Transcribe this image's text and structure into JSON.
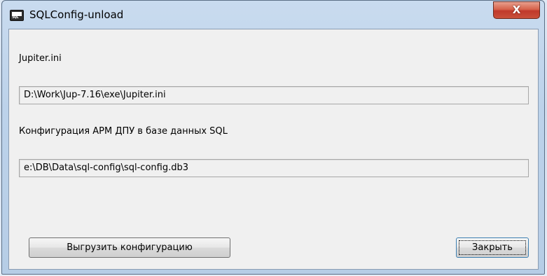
{
  "window": {
    "title": "SQLConfig-unload",
    "icon_text": "SQL",
    "close_glyph": "X"
  },
  "form": {
    "ini_label": "Jupiter.ini",
    "ini_path": "D:\\Work\\Jup-7.16\\exe\\Jupiter.ini",
    "db_label": "Конфигурация АРМ ДПУ в базе данных SQL",
    "db_path": "e:\\DB\\Data\\sql-config\\sql-config.db3"
  },
  "buttons": {
    "unload": "Выгрузить конфигурацию",
    "close": "Закрыть"
  }
}
